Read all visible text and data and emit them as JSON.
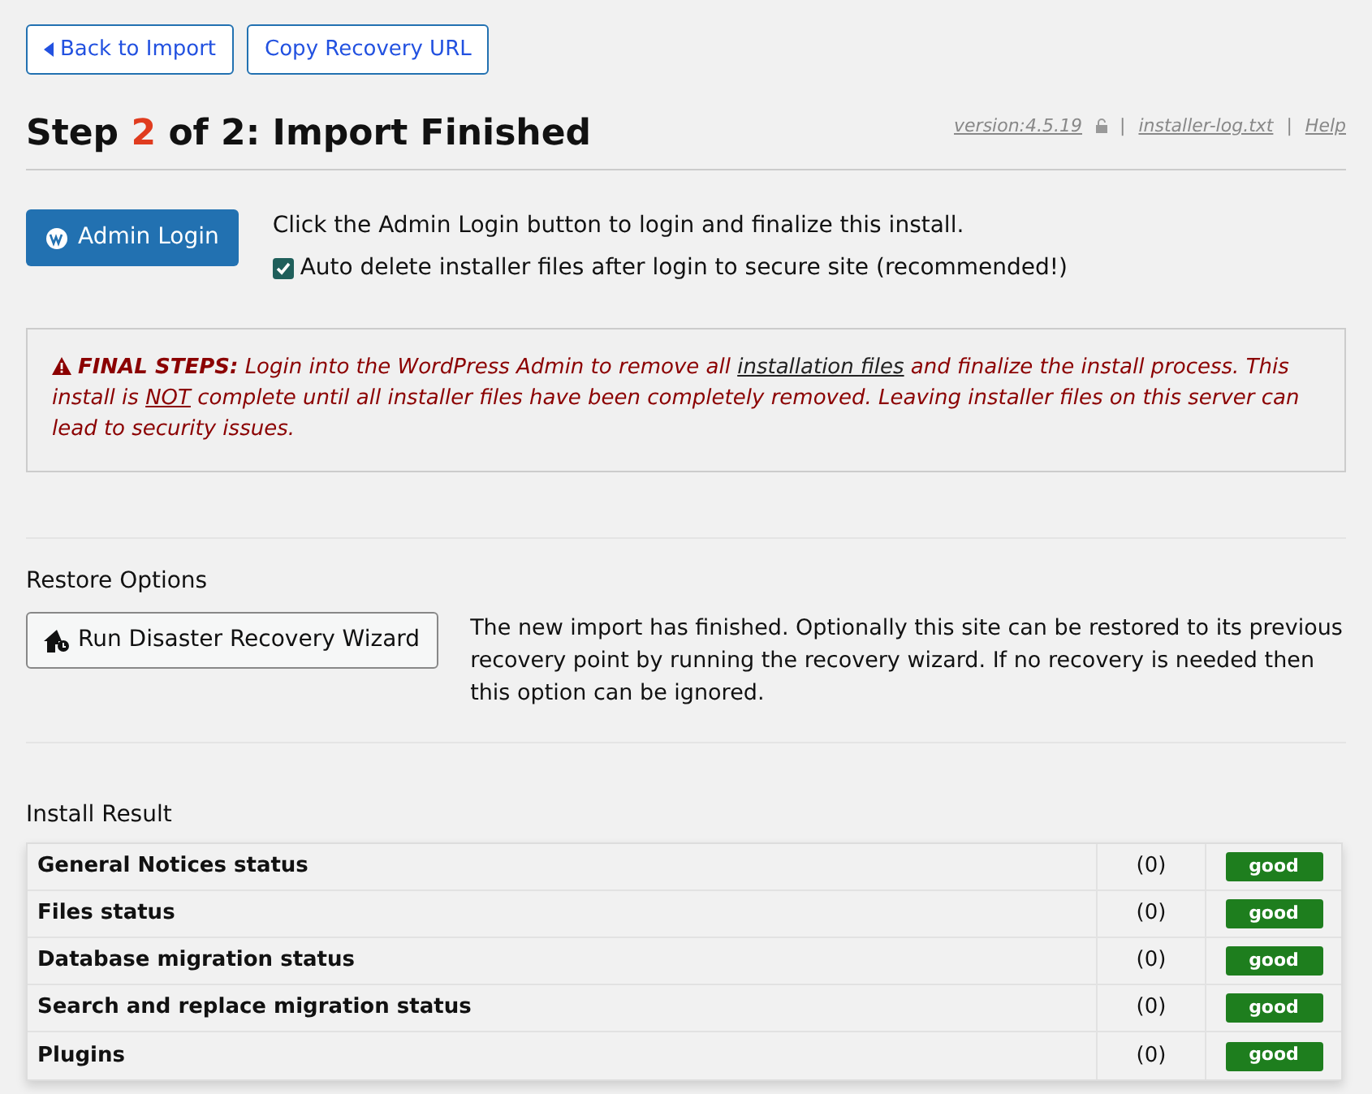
{
  "top_buttons": [
    {
      "label": "Back to Import",
      "kind": "back"
    },
    {
      "label": "Copy Recovery URL",
      "kind": "plain"
    }
  ],
  "heading": {
    "prefix": "Step",
    "step": "2",
    "suffix": "of 2: Import Finished"
  },
  "header_links": [
    {
      "label": "version:4.5.19",
      "kind": "locked"
    },
    {
      "label": "installer-log.txt",
      "kind": "plain"
    },
    {
      "label": "Help",
      "kind": "plain"
    }
  ],
  "separator": "|",
  "admin_login": {
    "button": "Admin Login",
    "hint": "Click the Admin Login button to login and finalize this install.",
    "auto_delete": {
      "label": "Auto delete installer files after login to secure site (recommended!)",
      "checked": true
    }
  },
  "notice": {
    "label": "FINAL STEPS:",
    "segments": [
      {
        "kind": "text",
        "text": "Login into the WordPress Admin to remove all "
      },
      {
        "kind": "link",
        "text": "installation files"
      },
      {
        "kind": "text",
        "text": " and finalize the install process. This install is "
      },
      {
        "kind": "underline",
        "text": "NOT"
      },
      {
        "kind": "text",
        "text": " complete until all installer files have been completely removed. Leaving installer files on this server can lead to security issues."
      }
    ]
  },
  "restore": {
    "title": "Restore Options",
    "button": "Run Disaster Recovery Wizard",
    "description": "The new import has finished. Optionally this site can be restored to its previous recovery point by running the recovery wizard. If no recovery is needed then this option can be ignored."
  },
  "install_result": {
    "title": "Install Result",
    "rows": [
      {
        "name": "General Notices status",
        "count": "(0)",
        "status": "good"
      },
      {
        "name": "Files status",
        "count": "(0)",
        "status": "good"
      },
      {
        "name": "Database migration status",
        "count": "(0)",
        "status": "good"
      },
      {
        "name": "Search and replace migration status",
        "count": "(0)",
        "status": "good"
      },
      {
        "name": "Plugins",
        "count": "(0)",
        "status": "good"
      }
    ]
  }
}
